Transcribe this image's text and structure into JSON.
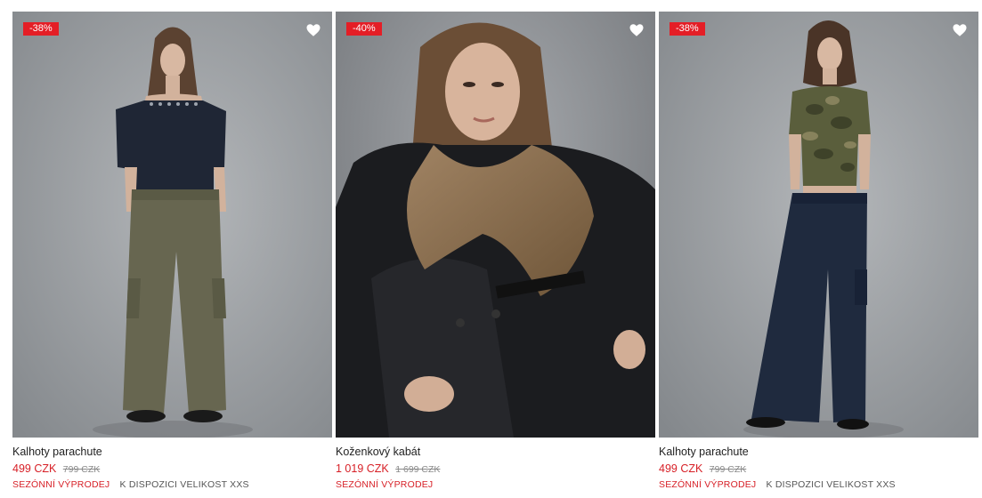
{
  "products": [
    {
      "discount": "-38%",
      "name": "Kalhoty parachute",
      "price": "499 CZK",
      "old_price": "799 CZK",
      "sale_tag": "SEZÓNNÍ VÝPRODEJ",
      "availability": "K DISPOZICI VELIKOST XXS"
    },
    {
      "discount": "-40%",
      "name": "Koženkový kabát",
      "price": "1 019 CZK",
      "old_price": "1 699 CZK",
      "sale_tag": "SEZÓNNÍ VÝPRODEJ",
      "availability": ""
    },
    {
      "discount": "-38%",
      "name": "Kalhoty parachute",
      "price": "499 CZK",
      "old_price": "799 CZK",
      "sale_tag": "SEZÓNNÍ VÝPRODEJ",
      "availability": "K DISPOZICI VELIKOST XXS"
    }
  ],
  "colors": {
    "sale_red": "#d71f26",
    "badge_red": "#e41e26",
    "old_price_gray": "#8a8a8a"
  },
  "icons": {
    "wishlist": "heart-icon"
  }
}
